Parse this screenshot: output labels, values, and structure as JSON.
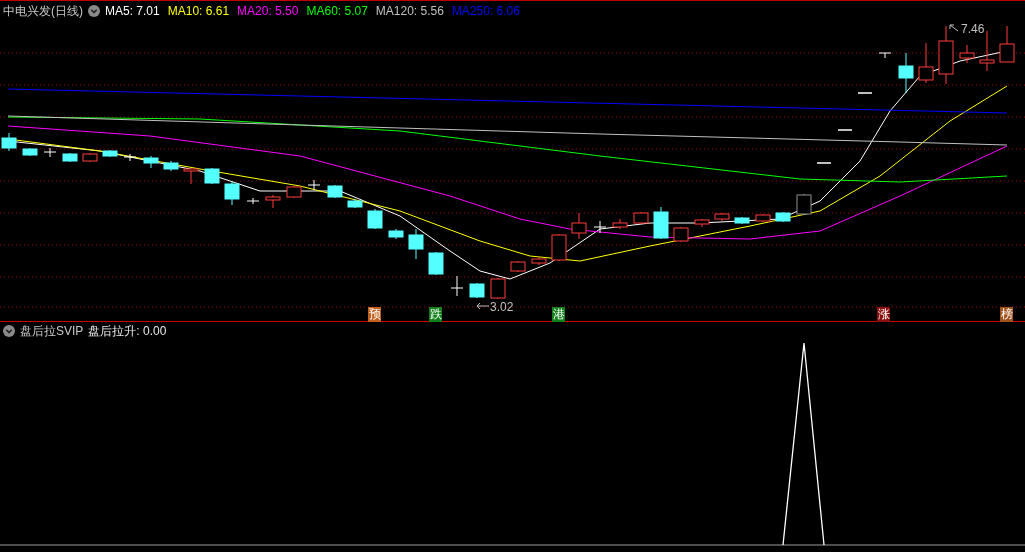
{
  "chart": {
    "title": "中电兴发(日线)",
    "ma_legend": [
      {
        "label": "MA5: 7.01",
        "color": "#ffffff"
      },
      {
        "label": "MA10: 6.61",
        "color": "#ffff00"
      },
      {
        "label": "MA20: 5.50",
        "color": "#ff00ff"
      },
      {
        "label": "MA60: 5.07",
        "color": "#00ff00"
      },
      {
        "label": "MA120: 5.56",
        "color": "#c0c0c0"
      },
      {
        "label": "MA250: 6.06",
        "color": "#0000ff"
      }
    ],
    "high_label": "7.46",
    "low_label": "3.02",
    "markers": [
      {
        "label": "预",
        "color": "#c0601c"
      },
      {
        "label": "跌",
        "color": "#12801a"
      },
      {
        "label": "港",
        "color": "#12801a"
      },
      {
        "label": "涨",
        "color": "#8a0e0e"
      },
      {
        "label": "榜",
        "color": "#a0521c"
      }
    ]
  },
  "indicator": {
    "name": "盘后拉SVIP",
    "reading": "盘后拉升: 0.00"
  }
}
